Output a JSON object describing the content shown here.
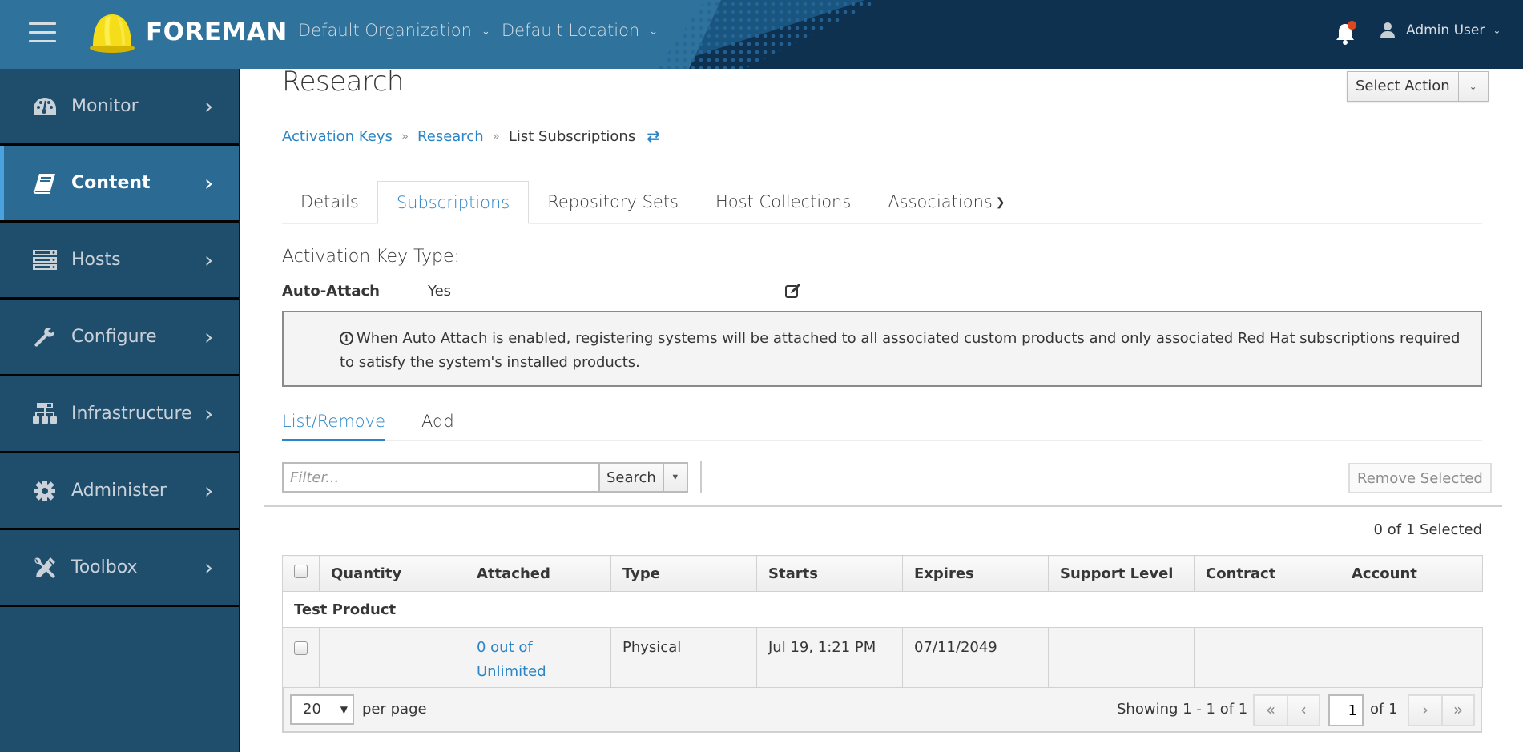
{
  "header": {
    "brand": "FOREMAN",
    "organization": "Default Organization",
    "location": "Default Location",
    "user": "Admin User",
    "notification_badge_color": "#e0461b"
  },
  "sidebar": {
    "items": [
      {
        "label": "Monitor",
        "icon": "dashboard-icon",
        "active": false
      },
      {
        "label": "Content",
        "icon": "book-icon",
        "active": true
      },
      {
        "label": "Hosts",
        "icon": "server-icon",
        "active": false
      },
      {
        "label": "Configure",
        "icon": "wrench-icon",
        "active": false
      },
      {
        "label": "Infrastructure",
        "icon": "sitemap-icon",
        "active": false
      },
      {
        "label": "Administer",
        "icon": "gear-icon",
        "active": false
      },
      {
        "label": "Toolbox",
        "icon": "tools-icon",
        "active": false
      }
    ]
  },
  "page": {
    "title": "Research",
    "select_action": "Select Action",
    "breadcrumb": {
      "activation_keys": "Activation Keys",
      "research": "Research",
      "current": "List Subscriptions"
    },
    "tabs": [
      {
        "label": "Details",
        "active": false
      },
      {
        "label": "Subscriptions",
        "active": true
      },
      {
        "label": "Repository Sets",
        "active": false
      },
      {
        "label": "Host Collections",
        "active": false
      },
      {
        "label": "Associations",
        "active": false
      }
    ],
    "activation_key_type": "Activation Key Type:",
    "auto_attach_label": "Auto-Attach",
    "auto_attach_value": "Yes",
    "info_text": "When Auto Attach is enabled, registering systems will be attached to all associated custom products and only associated Red Hat subscriptions required to satisfy the system's installed products.",
    "subtabs": [
      {
        "label": "List/Remove",
        "active": true
      },
      {
        "label": "Add",
        "active": false
      }
    ],
    "filter_placeholder": "Filter...",
    "search_label": "Search",
    "remove_selected": "Remove Selected",
    "selected_count": "0 of 1 Selected"
  },
  "table": {
    "columns": [
      "Quantity",
      "Attached",
      "Type",
      "Starts",
      "Expires",
      "Support Level",
      "Contract",
      "Account"
    ],
    "groups": [
      {
        "name": "Test Product",
        "rows": [
          {
            "quantity": "",
            "attached_line1": "0 out of",
            "attached_line2": "Unlimited",
            "type": "Physical",
            "starts": "Jul 19, 1:21 PM",
            "expires": "07/11/2049",
            "support_level": "",
            "contract": "",
            "account": ""
          }
        ]
      }
    ]
  },
  "pagination": {
    "per_page": "20",
    "per_page_label": "per page",
    "showing": "Showing 1 - 1 of 1",
    "current_page": "1",
    "of_pages": "of 1",
    "first": "«",
    "prev": "‹",
    "next": "›",
    "last": "»"
  },
  "colors": {
    "link": "#2b85c6",
    "sidebar_bg": "#1f4d6c",
    "sidebar_active": "#2a6a93",
    "navbar_dark": "#0f3150"
  }
}
